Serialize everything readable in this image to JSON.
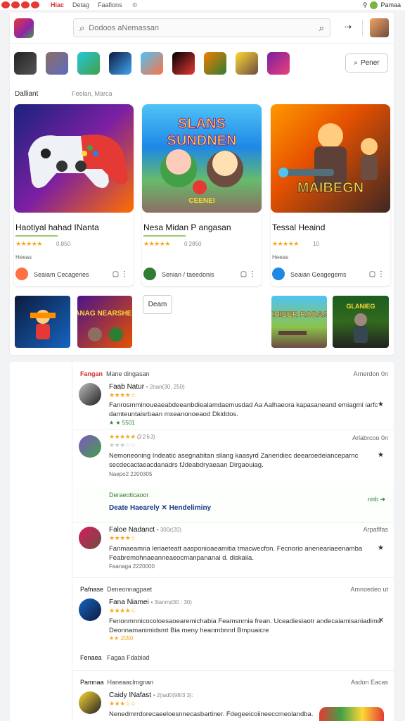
{
  "topbar": {
    "nav": [
      "Hiac",
      "Detag",
      "Faafions"
    ],
    "settings": "⚙",
    "account": "Pamaa"
  },
  "search": {
    "placeholder": "Dodoos aNemassan"
  },
  "filter_button": "Pener",
  "section": {
    "title": "Dalliant",
    "subtitle": "Feelan, Marca"
  },
  "featured": [
    {
      "title": "Haotiyal hahad INanta",
      "stars": "★★★★★",
      "rating": "0.850",
      "label": "Heeas",
      "developer": "Seaiam Cecageries"
    },
    {
      "title": "Nesa Midan P angasan",
      "stars": "★★★★★",
      "rating": "0 2850",
      "label": "",
      "developer": "Senian / taeedonis"
    },
    {
      "title": "Tessal Heaind",
      "stars": "★★★★★",
      "rating": "10",
      "label": "Heeas",
      "developer": "Seaian Geagegems"
    }
  ],
  "more_button": "Deam",
  "art_text": {
    "g2_top": "SLANS",
    "g2_mid": "SUNDNEN",
    "g2_bot": "CEENEI",
    "g3": "MAIBEGN",
    "t2": "IANAG NEARSHER",
    "t3": "CHIEER RODAG",
    "t4": "GLANIEG"
  },
  "reviews": [
    {
      "header_a": "Fangan",
      "header_b": "Mane dingasan",
      "date": "Arnerdon 0n",
      "name": "Faab Natur",
      "meta": "• 2nan(30, 250)",
      "stars": "★★★★☆",
      "text": "Fanrosmminoueaeabdeeanbdiealamdaemusdad Aa Aalhaeora kapasaneand emiagmi iarfc damteuntaisrbaan mxeanonoeaod Dkiddos.",
      "footer": "★ ★ 5501"
    },
    {
      "name": "",
      "meta": "(3 2 6 3)",
      "stars": "★★★★★",
      "stars2": "★★★☆☆",
      "text": "Nemoneoning Indeatic asegnabitan sliang kaasyrd Zaneridiec deearoedeianceparnc secdecactaeacdanadrs fJdeabdryaeaan Dirgaouiag.",
      "footer": "Naepo2 2200305"
    },
    {
      "reply_title": "Deraeoticaoor",
      "reply_link": "Deate Haearely ✕ Hendeliminy",
      "reply_count": "nnb ➜"
    },
    {
      "name": "Faloe Nadanct",
      "meta": "• 300r(20)",
      "stars": "★★★★☆",
      "text": "Fanmaeamna leriaeteatt aasponioaeamitia tmacwecfon. Fecnorio aneneariaeenamba Feabremohnaeanneaeocmanpananai d. diskaiia.",
      "footer": "Faanaga 2220000",
      "date": "Arpaflfas"
    },
    {
      "header_a": "Pafnase",
      "header_b": "Deneonnagpaet",
      "date": "Amnoedeo ut",
      "name": "Fana Niamei",
      "meta": "• 3ianmd30 : 30)",
      "stars": "★★★★☆",
      "text": "Fenonmnnicocoloesaoearemichabia Feamsnmia frean. Uceadiesiaotr andecaiamisaniadimd Deonnamanimidsmt Bia meny heanmbnnrl Bmpuaicre",
      "footer": "★★ 2050"
    },
    {
      "header_a": "Fenaea",
      "header_b": "Fagaa Fdabiad"
    },
    {
      "header_a": "Pamnaa",
      "header_b": "Haneaaclmgnan",
      "date": "Asdon Eacas",
      "name": "Caidy INafast",
      "meta": "• 2(iad0(98/3 3):",
      "stars": "★★★☆☆",
      "text": "Nenedmrrdorecaeeloesnnecasbartiner. Fdegeeicoiineeccmeolandba."
    }
  ]
}
